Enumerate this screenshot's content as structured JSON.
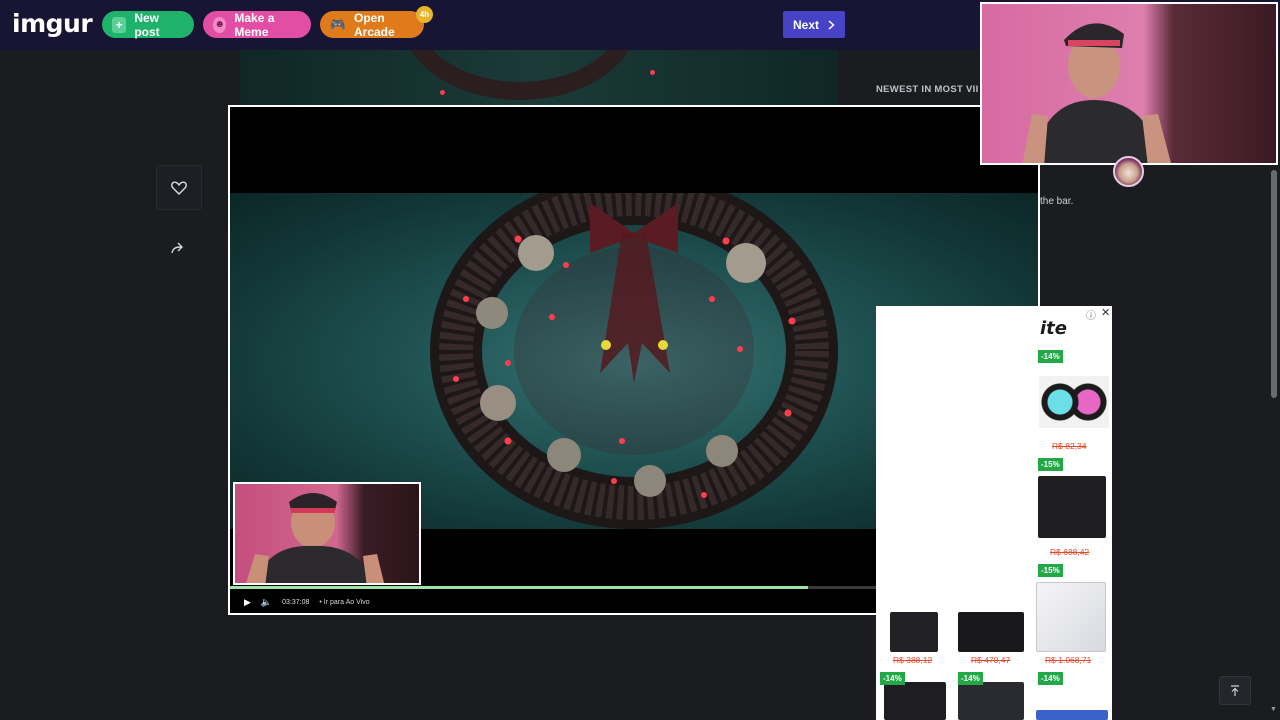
{
  "app": {
    "logo": "imgur"
  },
  "header": {
    "new_post": "New post",
    "make_meme": "Make a Meme",
    "open_arcade": "Open Arcade",
    "arcade_badge": "4h",
    "next": "Next"
  },
  "sidebar_right": {
    "newest_heading": "NEWEST IN MOST VII",
    "snippet": "the bar."
  },
  "player": {
    "time": "03:37:08",
    "live_label": "Ir para Ao Vivo",
    "progress_fraction": 0.715,
    "icons": [
      "play-icon",
      "volume-icon",
      "pip-icon",
      "clip-icon",
      "subtitles-icon",
      "fullscreen-icon",
      "theater-icon",
      "settings-icon"
    ]
  },
  "ad": {
    "brand": "ite",
    "items": [
      {
        "discount": "-14%",
        "price": "R$ 82,34"
      },
      {
        "discount": "-15%",
        "price": "R$ 688,42"
      },
      {
        "discount": "-15%",
        "price": "R$ 1.068,71"
      },
      {
        "discount": "",
        "price": "R$ 388,12"
      },
      {
        "discount": "",
        "price": "R$ 470,47"
      },
      {
        "discount": "-14%",
        "price": ""
      },
      {
        "discount": "-14%",
        "price": ""
      },
      {
        "discount": "-14%",
        "price": ""
      }
    ]
  },
  "colors": {
    "topbar": "#171533",
    "new_post": "#1fb26b",
    "make_meme": "#e14ea4",
    "open_arcade": "#e07b1b",
    "next": "#4643c7",
    "progress": "#9fe3a9"
  }
}
